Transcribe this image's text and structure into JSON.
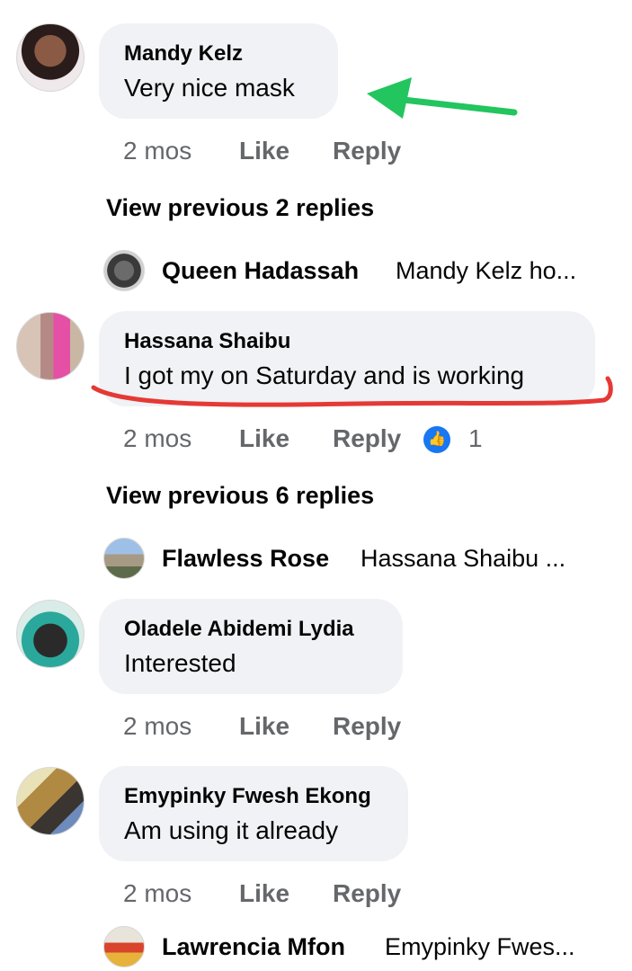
{
  "comments": [
    {
      "author": "Mandy Kelz",
      "text": "Very nice mask",
      "time": "2 mos",
      "like_label": "Like",
      "reply_label": "Reply",
      "avatar_icon": "profile-photo"
    },
    {
      "author": "Hassana Shaibu",
      "text": "I got my on Saturday and is working",
      "time": "2 mos",
      "like_label": "Like",
      "reply_label": "Reply",
      "reaction_count": "1",
      "reaction_icon": "thumbs-up-icon",
      "avatar_icon": "profile-photo"
    },
    {
      "author": "Oladele Abidemi Lydia",
      "text": "Interested",
      "time": "2 mos",
      "like_label": "Like",
      "reply_label": "Reply",
      "avatar_icon": "profile-photo"
    },
    {
      "author": "Emypinky Fwesh Ekong",
      "text": "Am using it already",
      "time": "2 mos",
      "like_label": "Like",
      "reply_label": "Reply",
      "avatar_icon": "profile-photo"
    }
  ],
  "view_previous": [
    {
      "label": "View previous 2 replies"
    },
    {
      "label": "View previous 6 replies"
    }
  ],
  "reply_previews": [
    {
      "name": "Queen Hadassah",
      "snippet": "Mandy Kelz ho..."
    },
    {
      "name": "Flawless Rose",
      "snippet": "Hassana Shaibu ..."
    },
    {
      "name": "Lawrencia Mfon",
      "snippet": "Emypinky Fwes..."
    }
  ],
  "annotations": {
    "arrow_color": "#22c55e",
    "underline_color": "#e53935"
  },
  "colors": {
    "bubble": "#f0f2f5",
    "meta_text": "#65676b",
    "like_badge": "#1877f2"
  }
}
